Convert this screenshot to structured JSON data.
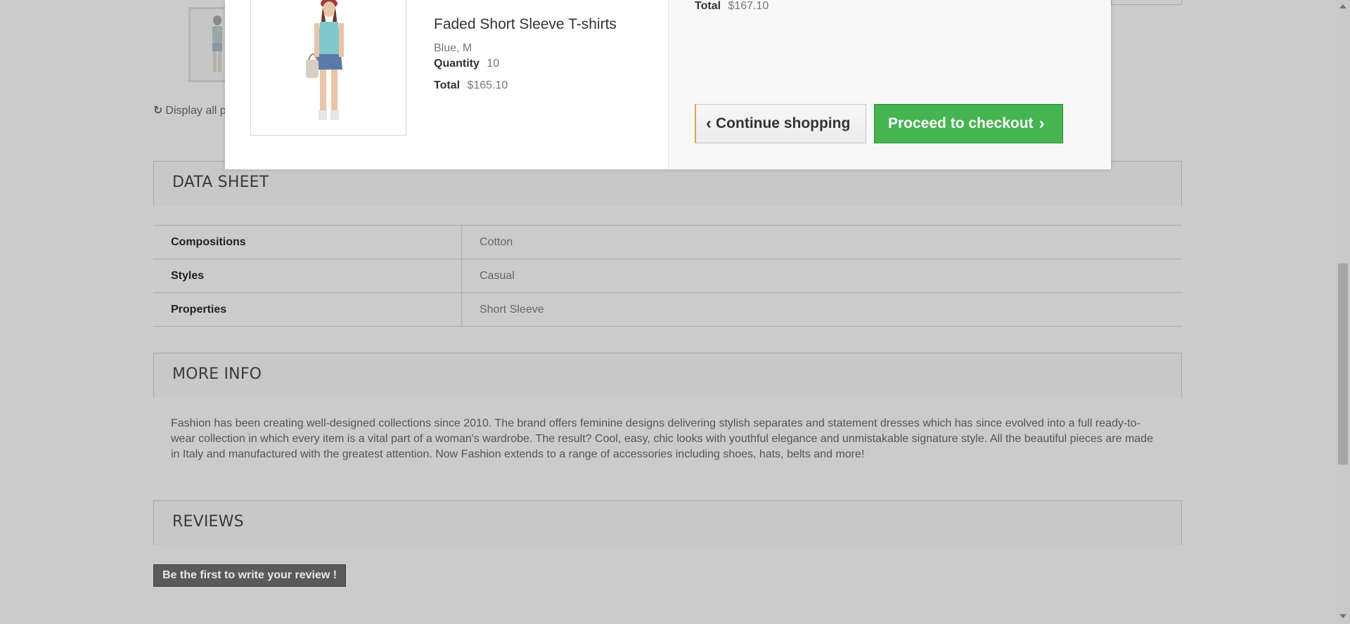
{
  "product_page": {
    "display_all_label": "Display all p",
    "data_sheet": {
      "title": "DATA SHEET",
      "rows": [
        {
          "key": "Compositions",
          "value": "Cotton"
        },
        {
          "key": "Styles",
          "value": "Casual"
        },
        {
          "key": "Properties",
          "value": "Short Sleeve"
        }
      ]
    },
    "more_info": {
      "title": "MORE INFO",
      "text": "Fashion has been creating well-designed collections since 2010. The brand offers feminine designs delivering stylish separates and statement dresses which has since evolved into a full ready-to-wear collection in which every item is a vital part of a woman's wardrobe. The result? Cool, easy, chic looks with youthful elegance and unmistakable signature style. All the beautiful pieces are made in Italy and manufactured with the greatest attention. Now Fashion extends to a range of accessories including shoes, hats, belts and more!"
    },
    "reviews": {
      "title": "REVIEWS",
      "write_review_label": "Be the first to write your review !"
    }
  },
  "cart_modal": {
    "product": {
      "name": "Faded Short Sleeve T-shirts",
      "attributes": "Blue, M",
      "quantity_label": "Quantity",
      "quantity": "10",
      "total_label": "Total",
      "total": "$165.10"
    },
    "cart_total_label": "Total",
    "cart_total": "$167.10",
    "continue_label": "Continue shopping",
    "checkout_label": "Proceed to checkout",
    "colors": {
      "checkout_bg": "#44b54f",
      "overlay_bg": "#cbcbcb"
    }
  }
}
